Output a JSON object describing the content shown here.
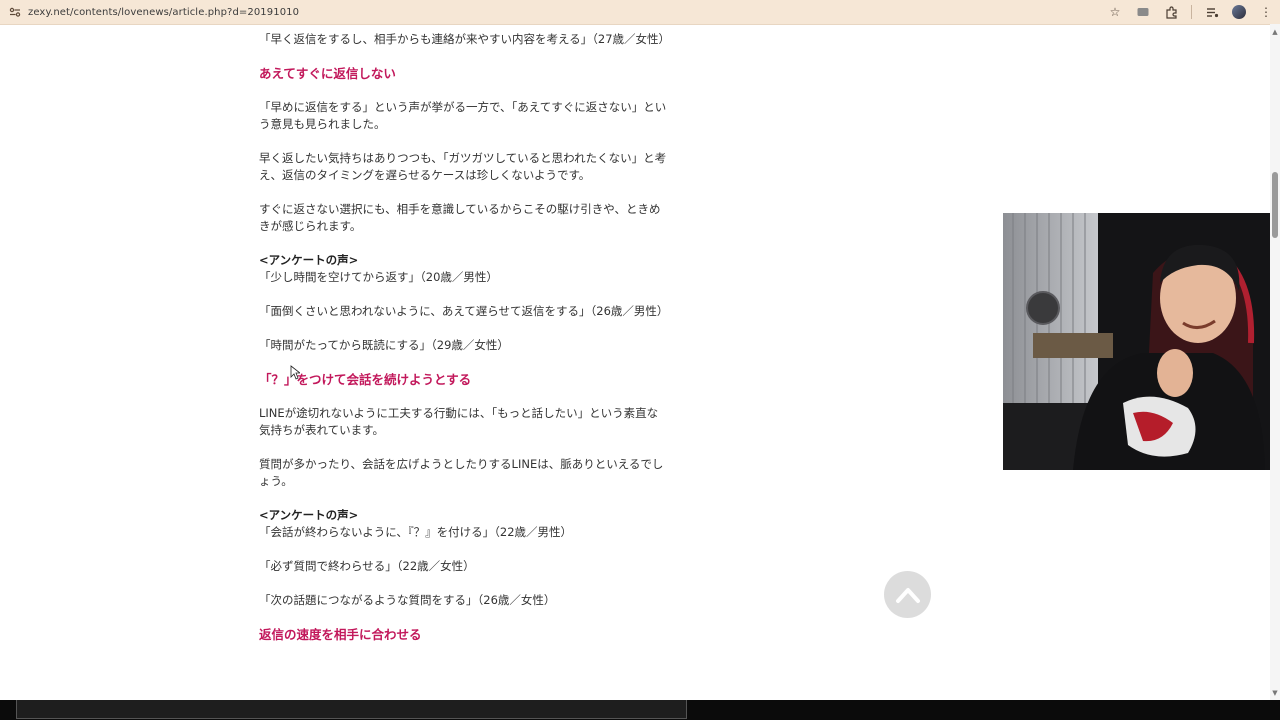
{
  "browser": {
    "url": "zexy.net/contents/lovenews/article.php?d=20191010"
  },
  "article": {
    "p1": "「早く返信をするし、相手からも連絡が来やすい内容を考える」（27歳／女性）",
    "h1": "あえてすぐに返信しない",
    "p2": "「早めに返信をする」という声が挙がる一方で、「あえてすぐに返さない」という意見も見られました。",
    "p3": "早く返したい気持ちはありつつも、「ガツガツしていると思われたくない」と考え、返信のタイミングを遅らせるケースは珍しくないようです。",
    "p4": "すぐに返さない選択にも、相手を意識しているからこその駆け引きや、ときめきが感じられます。",
    "survey1_title": "<アンケートの声>",
    "survey1_q1": "「少し時間を空けてから返す」（20歳／男性）",
    "survey1_q2": "「面倒くさいと思われないように、あえて遅らせて返信をする」（26歳／男性）",
    "survey1_q3": "「時間がたってから既読にする」（29歳／女性）",
    "h2": "「？」をつけて会話を続けようとする",
    "p5": "LINEが途切れないように工夫する行動には、「もっと話したい」という素直な気持ちが表れています。",
    "p6": "質問が多かったり、会話を広げようとしたりするLINEは、脈ありといえるでしょう。",
    "survey2_title": "<アンケートの声>",
    "survey2_q1": "「会話が終わらないように、『？』を付ける」（22歳／男性）",
    "survey2_q2": "「必ず質問で終わらせる」（22歳／女性）",
    "survey2_q3": "「次の話題につながるような質問をする」（26歳／女性）",
    "h3": "返信の速度を相手に合わせる"
  },
  "colors": {
    "heading": "#c2185b",
    "topbar": "#f6e7d6"
  }
}
